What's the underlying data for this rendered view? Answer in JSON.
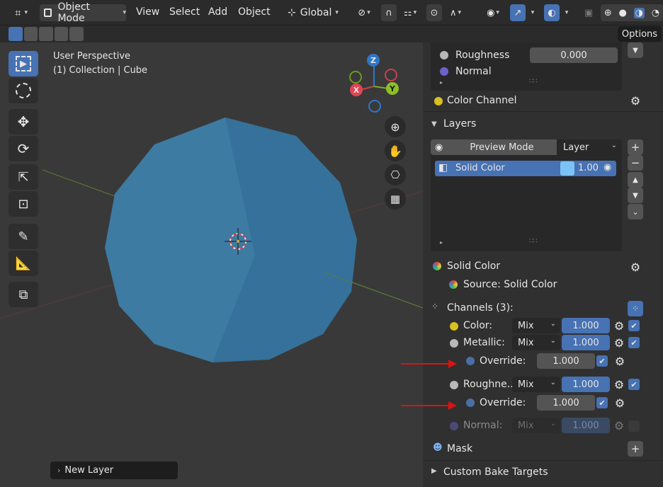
{
  "header": {
    "mode_label": "Object Mode",
    "menus": [
      "View",
      "Select",
      "Add",
      "Object"
    ],
    "transform_orientation": "Global",
    "options_label": "Options"
  },
  "viewport": {
    "perspective_label": "User Perspective",
    "collection_label": "(1) Collection | Cube",
    "gizmo": {
      "z": "Z",
      "x": "X",
      "y": "Y"
    },
    "new_layer_label": "New Layer"
  },
  "panel": {
    "top_props": [
      {
        "label": "Roughness",
        "value": "0.000"
      },
      {
        "label": "Normal",
        "value": ""
      }
    ],
    "color_channel_label": "Color Channel",
    "layers_label": "Layers",
    "preview_mode_label": "Preview Mode",
    "layer_dropdown": "Layer",
    "layer_item": {
      "name": "Solid Color",
      "value": "1.00"
    },
    "solid_color_label": "Solid Color",
    "source_label": "Source: Solid Color",
    "channels_label": "Channels (3):",
    "channels": [
      {
        "label": "Color:",
        "blend": "Mix",
        "value": "1.000"
      },
      {
        "label": "Metallic:",
        "blend": "Mix",
        "value": "1.000"
      },
      {
        "label": "Override:",
        "value": "1.000"
      },
      {
        "label": "Roughne...",
        "blend": "Mix",
        "value": "1.000"
      },
      {
        "label": "Override:",
        "value": "1.000"
      },
      {
        "label": "Normal:",
        "blend": "Mix",
        "value": "1.000"
      }
    ],
    "mask_label": "Mask",
    "custom_bake_label": "Custom Bake Targets"
  },
  "colors": {
    "accent": "#4772b3",
    "sphere": "#3d7ba3",
    "arrow": "#e01010"
  }
}
